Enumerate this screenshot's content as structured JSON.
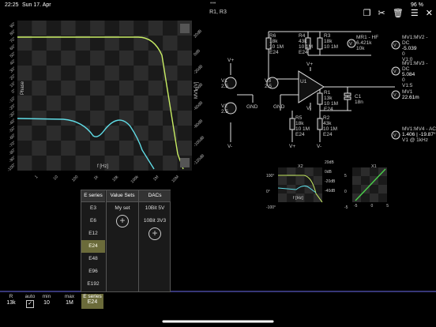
{
  "status": {
    "time": "22:25",
    "date": "Sun 17. Apr",
    "battery": "96 %",
    "dots": "•••"
  },
  "title": "R1, R3",
  "toolbar": {
    "icons": [
      "copy-icon",
      "scissors-icon",
      "trash-icon",
      "list-icon",
      "close-icon"
    ]
  },
  "bode": {
    "left_ticks": [
      "90°",
      "80°",
      "70°",
      "60°",
      "50°",
      "40°",
      "30°",
      "20°",
      "10°",
      "0°",
      "-10°",
      "-20°",
      "-30°",
      "-40°",
      "-50°",
      "-60°",
      "-70°",
      "-80°",
      "-90°",
      "-100°"
    ],
    "right_ticks": [
      "20dB",
      "0dB",
      "-20dB",
      "-40dB",
      "-60dB",
      "-80dB",
      "-100dB",
      "-120dB"
    ],
    "x_ticks": [
      "1",
      "10",
      "100",
      "1k",
      "10k",
      "100k",
      "1M",
      "10M"
    ],
    "xlabel": "f [Hz]",
    "ylabel_left": "Phase",
    "ylabel_right": "MV1 [V]"
  },
  "schematic": {
    "r6": [
      "R6",
      "18k",
      "10 1M",
      "E24"
    ],
    "r4": [
      "R4",
      "43k",
      "10 1M",
      "E24"
    ],
    "r3": [
      "R3",
      "18k",
      "10 1M"
    ],
    "mr1": [
      "MR1 - HF",
      "6.421k",
      "10k"
    ],
    "r1": [
      "R1",
      "13k",
      "10 1M",
      "E24"
    ],
    "r5": [
      "R5",
      "18k",
      "10 1M",
      "E24"
    ],
    "r2": [
      "R2",
      "43k",
      "10 1M",
      "E24"
    ],
    "c1": [
      "C1",
      "18n"
    ],
    "u1": "U1",
    "v1": [
      "V1",
      "2.5"
    ],
    "v2": [
      "V2",
      "2.5"
    ],
    "v3": [
      "V3",
      "2.5"
    ],
    "vplus": "V+",
    "vminus": "V-",
    "gnd": "GND",
    "mv2": [
      "MV1:MV2 - DC",
      "-5.039",
      "0",
      "V1:0"
    ],
    "mv3": [
      "MV1:MV3 - DC",
      "5.084",
      "0",
      "V1:5"
    ],
    "mv1": [
      "MV1",
      "22.61m"
    ],
    "mv4": [
      "MV1:MV4 - AC",
      "1.406 | -19.87°",
      "V1 @ 1kHz"
    ]
  },
  "mini": {
    "bode_ticks_l": [
      "100°",
      "0°",
      "-100°"
    ],
    "bode_ticks_r": [
      "20dB",
      "0dB",
      "-20dB",
      "-40dB"
    ],
    "bode_x": [
      "10",
      "1k",
      "100k"
    ],
    "bode_labels": [
      "X2",
      "Phase",
      "f [Hz]"
    ],
    "xy_x": [
      "-5",
      "0",
      "5"
    ],
    "xy_y": [
      "5",
      "0",
      "-5"
    ],
    "xy_labels": [
      "X1",
      "MV1"
    ]
  },
  "table": {
    "headers": [
      "E series",
      "Value Sets",
      "DACs"
    ],
    "e_series": [
      "E3",
      "E6",
      "E12",
      "E24",
      "E48",
      "E96",
      "E192"
    ],
    "selected": "E24",
    "value_sets": [
      "My set"
    ],
    "dacs": [
      "10Bit 5V",
      "10Bit 3V3"
    ]
  },
  "bottom": {
    "r_label": "R",
    "r_value": "13k",
    "auto_label": "auto",
    "min_label": "min",
    "min_value": "10",
    "max_label": "max",
    "max_value": "1M",
    "eseries_label": "E series",
    "eseries_value": "E24"
  },
  "colors": {
    "magnitude": "#c9ee64",
    "phase": "#60dce6",
    "plot_bg": "#262626",
    "selected": "#6b6b3a"
  }
}
